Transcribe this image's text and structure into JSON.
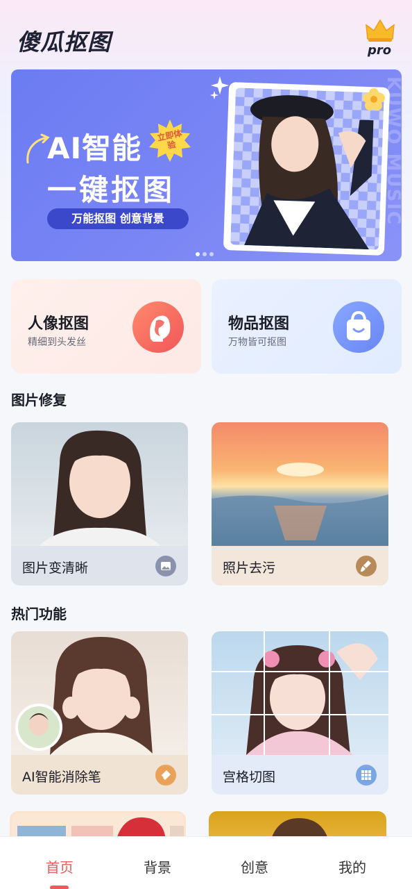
{
  "app": {
    "title": "傻瓜抠图",
    "pro_label": "pro"
  },
  "banner": {
    "line1": "AI智能",
    "line2": "一键抠图",
    "burst": "立即体验",
    "pill": "万能抠图 创意背景",
    "side_text": "KUWO MUSIC",
    "pages": 3,
    "current_page": 1
  },
  "features": [
    {
      "title": "人像抠图",
      "subtitle": "精细到头发丝",
      "icon": "portrait-icon"
    },
    {
      "title": "物品抠图",
      "subtitle": "万物皆可抠图",
      "icon": "bag-icon"
    }
  ],
  "sections": {
    "repair": {
      "title": "图片修复",
      "items": [
        {
          "label": "图片变清晰",
          "icon": "image-icon"
        },
        {
          "label": "照片去污",
          "icon": "brush-icon"
        }
      ]
    },
    "hot": {
      "title": "热门功能",
      "items": [
        {
          "label": "AI智能消除笔",
          "icon": "eraser-icon"
        },
        {
          "label": "宫格切图",
          "icon": "grid-icon"
        }
      ]
    }
  },
  "nav": {
    "items": [
      "首页",
      "背景",
      "创意",
      "我的"
    ],
    "active": "首页"
  },
  "colors": {
    "accent": "#ee5a5a",
    "banner": "#6b7cf2",
    "portrait_card": "#fde9e6",
    "object_card": "#e1ecff"
  }
}
